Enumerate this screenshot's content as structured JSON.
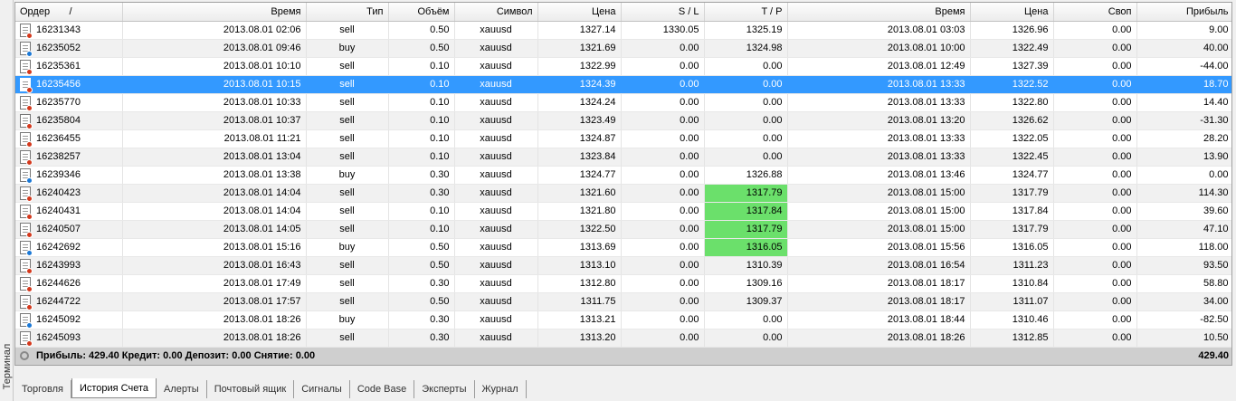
{
  "sidebar_label": "Терминал",
  "columns": [
    "Ордер",
    "Время",
    "Тип",
    "Объём",
    "Символ",
    "Цена",
    "S / L",
    "T / P",
    "Время",
    "Цена",
    "Своп",
    "Прибыль"
  ],
  "sort_marker": "/",
  "rows": [
    {
      "order": "16231343",
      "open_time": "2013.08.01 02:06",
      "type": "sell",
      "volume": "0.50",
      "symbol": "xauusd",
      "price": "1327.14",
      "sl": "1330.05",
      "tp": "1325.19",
      "close_time": "2013.08.01 03:03",
      "close_price": "1326.96",
      "swap": "0.00",
      "profit": "9.00"
    },
    {
      "order": "16235052",
      "open_time": "2013.08.01 09:46",
      "type": "buy",
      "volume": "0.50",
      "symbol": "xauusd",
      "price": "1321.69",
      "sl": "0.00",
      "tp": "1324.98",
      "close_time": "2013.08.01 10:00",
      "close_price": "1322.49",
      "swap": "0.00",
      "profit": "40.00"
    },
    {
      "order": "16235361",
      "open_time": "2013.08.01 10:10",
      "type": "sell",
      "volume": "0.10",
      "symbol": "xauusd",
      "price": "1322.99",
      "sl": "0.00",
      "tp": "0.00",
      "close_time": "2013.08.01 12:49",
      "close_price": "1327.39",
      "swap": "0.00",
      "profit": "-44.00"
    },
    {
      "order": "16235456",
      "open_time": "2013.08.01 10:15",
      "type": "sell",
      "volume": "0.10",
      "symbol": "xauusd",
      "price": "1324.39",
      "sl": "0.00",
      "tp": "0.00",
      "close_time": "2013.08.01 13:33",
      "close_price": "1322.52",
      "swap": "0.00",
      "profit": "18.70"
    },
    {
      "order": "16235770",
      "open_time": "2013.08.01 10:33",
      "type": "sell",
      "volume": "0.10",
      "symbol": "xauusd",
      "price": "1324.24",
      "sl": "0.00",
      "tp": "0.00",
      "close_time": "2013.08.01 13:33",
      "close_price": "1322.80",
      "swap": "0.00",
      "profit": "14.40"
    },
    {
      "order": "16235804",
      "open_time": "2013.08.01 10:37",
      "type": "sell",
      "volume": "0.10",
      "symbol": "xauusd",
      "price": "1323.49",
      "sl": "0.00",
      "tp": "0.00",
      "close_time": "2013.08.01 13:20",
      "close_price": "1326.62",
      "swap": "0.00",
      "profit": "-31.30"
    },
    {
      "order": "16236455",
      "open_time": "2013.08.01 11:21",
      "type": "sell",
      "volume": "0.10",
      "symbol": "xauusd",
      "price": "1324.87",
      "sl": "0.00",
      "tp": "0.00",
      "close_time": "2013.08.01 13:33",
      "close_price": "1322.05",
      "swap": "0.00",
      "profit": "28.20"
    },
    {
      "order": "16238257",
      "open_time": "2013.08.01 13:04",
      "type": "sell",
      "volume": "0.10",
      "symbol": "xauusd",
      "price": "1323.84",
      "sl": "0.00",
      "tp": "0.00",
      "close_time": "2013.08.01 13:33",
      "close_price": "1322.45",
      "swap": "0.00",
      "profit": "13.90"
    },
    {
      "order": "16239346",
      "open_time": "2013.08.01 13:38",
      "type": "buy",
      "volume": "0.30",
      "symbol": "xauusd",
      "price": "1324.77",
      "sl": "0.00",
      "tp": "1326.88",
      "close_time": "2013.08.01 13:46",
      "close_price": "1324.77",
      "swap": "0.00",
      "profit": "0.00"
    },
    {
      "order": "16240423",
      "open_time": "2013.08.01 14:04",
      "type": "sell",
      "volume": "0.30",
      "symbol": "xauusd",
      "price": "1321.60",
      "sl": "0.00",
      "tp": "1317.79",
      "close_time": "2013.08.01 15:00",
      "close_price": "1317.79",
      "swap": "0.00",
      "profit": "114.30"
    },
    {
      "order": "16240431",
      "open_time": "2013.08.01 14:04",
      "type": "sell",
      "volume": "0.10",
      "symbol": "xauusd",
      "price": "1321.80",
      "sl": "0.00",
      "tp": "1317.84",
      "close_time": "2013.08.01 15:00",
      "close_price": "1317.84",
      "swap": "0.00",
      "profit": "39.60"
    },
    {
      "order": "16240507",
      "open_time": "2013.08.01 14:05",
      "type": "sell",
      "volume": "0.10",
      "symbol": "xauusd",
      "price": "1322.50",
      "sl": "0.00",
      "tp": "1317.79",
      "close_time": "2013.08.01 15:00",
      "close_price": "1317.79",
      "swap": "0.00",
      "profit": "47.10"
    },
    {
      "order": "16242692",
      "open_time": "2013.08.01 15:16",
      "type": "buy",
      "volume": "0.50",
      "symbol": "xauusd",
      "price": "1313.69",
      "sl": "0.00",
      "tp": "1316.05",
      "close_time": "2013.08.01 15:56",
      "close_price": "1316.05",
      "swap": "0.00",
      "profit": "118.00"
    },
    {
      "order": "16243993",
      "open_time": "2013.08.01 16:43",
      "type": "sell",
      "volume": "0.50",
      "symbol": "xauusd",
      "price": "1313.10",
      "sl": "0.00",
      "tp": "1310.39",
      "close_time": "2013.08.01 16:54",
      "close_price": "1311.23",
      "swap": "0.00",
      "profit": "93.50"
    },
    {
      "order": "16244626",
      "open_time": "2013.08.01 17:49",
      "type": "sell",
      "volume": "0.30",
      "symbol": "xauusd",
      "price": "1312.80",
      "sl": "0.00",
      "tp": "1309.16",
      "close_time": "2013.08.01 18:17",
      "close_price": "1310.84",
      "swap": "0.00",
      "profit": "58.80"
    },
    {
      "order": "16244722",
      "open_time": "2013.08.01 17:57",
      "type": "sell",
      "volume": "0.50",
      "symbol": "xauusd",
      "price": "1311.75",
      "sl": "0.00",
      "tp": "1309.37",
      "close_time": "2013.08.01 18:17",
      "close_price": "1311.07",
      "swap": "0.00",
      "profit": "34.00"
    },
    {
      "order": "16245092",
      "open_time": "2013.08.01 18:26",
      "type": "buy",
      "volume": "0.30",
      "symbol": "xauusd",
      "price": "1313.21",
      "sl": "0.00",
      "tp": "0.00",
      "close_time": "2013.08.01 18:44",
      "close_price": "1310.46",
      "swap": "0.00",
      "profit": "-82.50"
    },
    {
      "order": "16245093",
      "open_time": "2013.08.01 18:26",
      "type": "sell",
      "volume": "0.30",
      "symbol": "xauusd",
      "price": "1313.20",
      "sl": "0.00",
      "tp": "0.00",
      "close_time": "2013.08.01 18:26",
      "close_price": "1312.85",
      "swap": "0.00",
      "profit": "10.50"
    }
  ],
  "selected_order": "16235456",
  "tp_hit_orders": [
    "16240423",
    "16240431",
    "16240507",
    "16242692"
  ],
  "highlight_color": "#6be06b",
  "selection_color": "#3399ff",
  "summary": {
    "text": "Прибыль: 429.40  Кредит: 0.00  Депозит: 0.00  Снятие: 0.00",
    "total": "429.40"
  },
  "tabs": [
    {
      "label": "Торговля",
      "active": false
    },
    {
      "label": "История Счета",
      "active": true
    },
    {
      "label": "Алерты",
      "active": false
    },
    {
      "label": "Почтовый ящик",
      "active": false
    },
    {
      "label": "Сигналы",
      "active": false
    },
    {
      "label": "Code Base",
      "active": false
    },
    {
      "label": "Эксперты",
      "active": false
    },
    {
      "label": "Журнал",
      "active": false
    }
  ],
  "icons": {
    "order_row": "order-document-icon",
    "summary": "summary-gear-icon"
  }
}
